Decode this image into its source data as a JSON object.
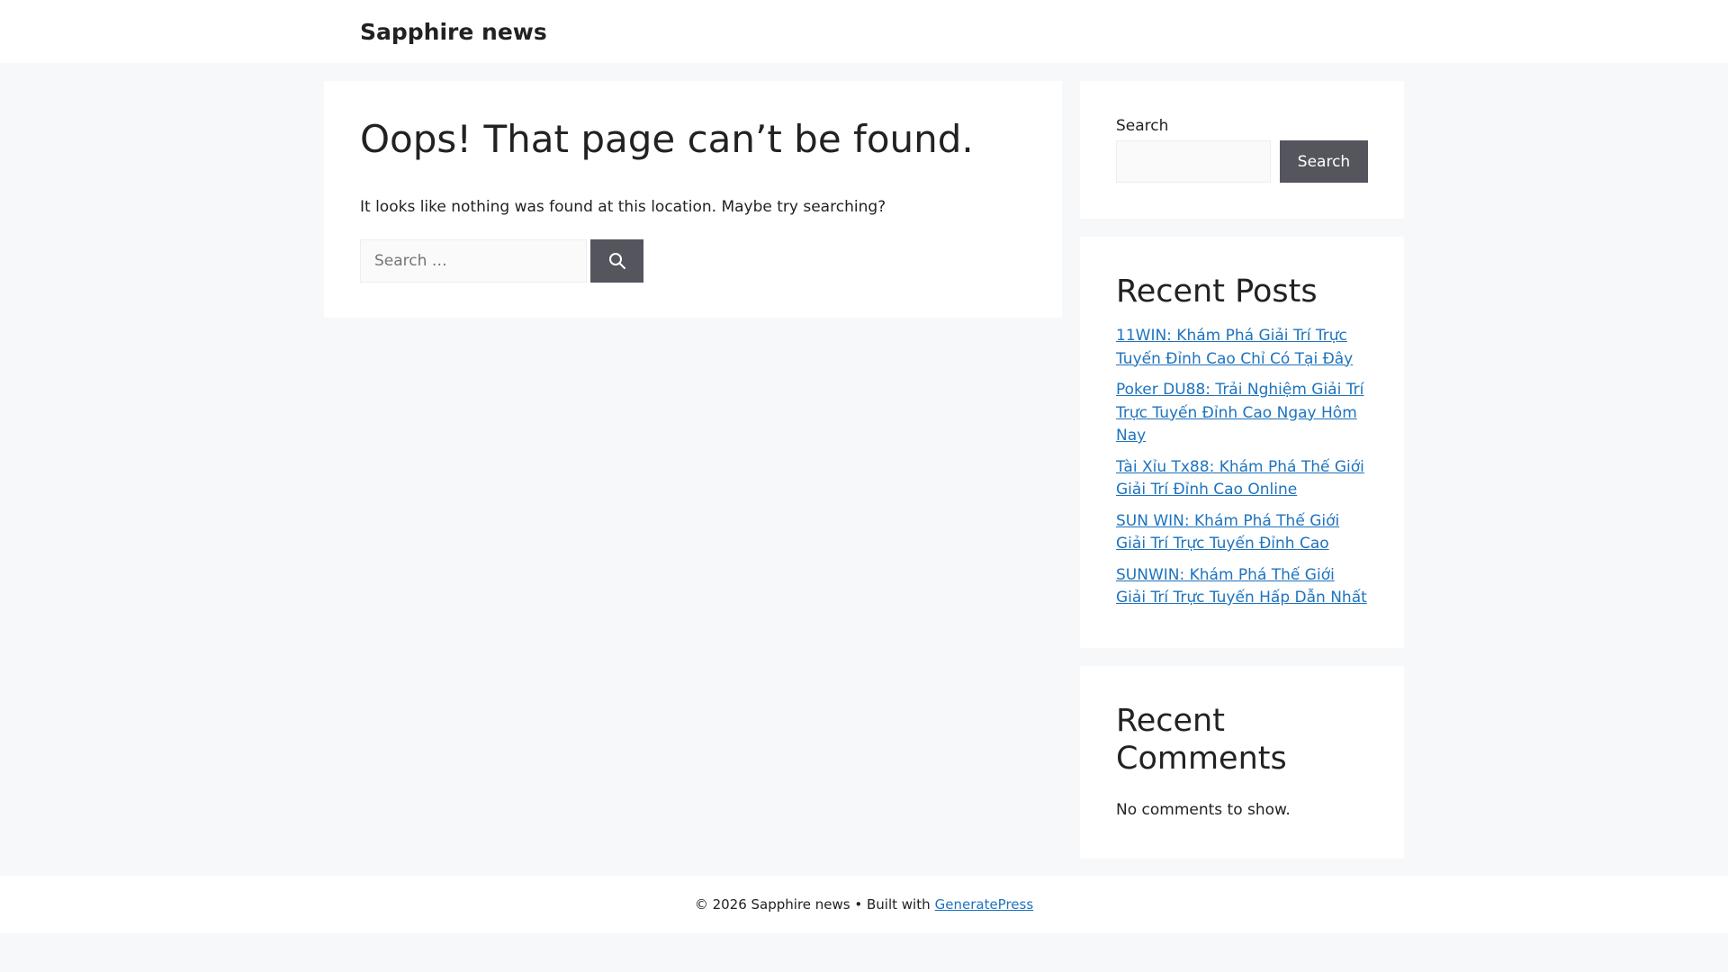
{
  "header": {
    "site_title": "Sapphire news"
  },
  "main": {
    "title": "Oops! That page can’t be found.",
    "message": "It looks like nothing was found at this location. Maybe try searching?",
    "search": {
      "placeholder": "Search …",
      "value": "",
      "icon": "search-icon"
    }
  },
  "sidebar": {
    "search_widget": {
      "label": "Search",
      "input_value": "",
      "button_label": "Search"
    },
    "recent_posts": {
      "title": "Recent Posts",
      "items": [
        {
          "label": "11WIN: Khám Phá Giải Trí Trực Tuyến Đỉnh Cao Chỉ Có Tại Đây"
        },
        {
          "label": "Poker DU88: Trải Nghiệm Giải Trí Trực Tuyến Đỉnh Cao Ngay Hôm Nay"
        },
        {
          "label": "Tài Xỉu Tx88: Khám Phá Thế Giới Giải Trí Đỉnh Cao Online"
        },
        {
          "label": "SUN WIN: Khám Phá Thế Giới Giải Trí Trực Tuyến Đỉnh Cao"
        },
        {
          "label": "SUNWIN: Khám Phá Thế Giới Giải Trí Trực Tuyến Hấp Dẫn Nhất"
        }
      ]
    },
    "recent_comments": {
      "title": "Recent Comments",
      "empty_text": "No comments to show."
    }
  },
  "footer": {
    "copyright": "© 2026 Sapphire news • Built with",
    "link_label": "GeneratePress"
  },
  "colors": {
    "background": "#f7f8f9",
    "surface": "#ffffff",
    "text": "#222222",
    "link": "#1e73be",
    "button": "#55555e"
  }
}
